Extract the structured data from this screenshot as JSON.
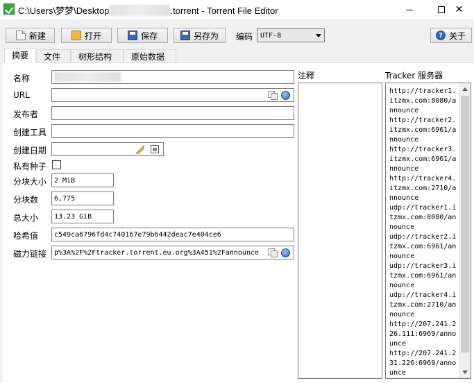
{
  "window": {
    "title_prefix": "C:\\Users\\梦梦\\Desktop",
    "title_suffix": ".torrent - Torrent File Editor"
  },
  "toolbar": {
    "new_label": "新建",
    "open_label": "打开",
    "save_label": "保存",
    "saveas_label": "另存为",
    "encoding_label": "编码",
    "encoding_value": "UTF-8",
    "about_label": "关于"
  },
  "tabs": [
    "摘要",
    "文件",
    "树形结构",
    "原始数据"
  ],
  "form": {
    "name_label": "名称",
    "url_label": "URL",
    "url_value": "",
    "publisher_label": "发布者",
    "publisher_value": "",
    "created_by_label": "创建工具",
    "created_by_value": "",
    "created_date_label": "创建日期",
    "created_date_value": "",
    "private_label": "私有种子",
    "private_checked": false,
    "piece_size_label": "分块大小",
    "piece_size_value": "2 MiB",
    "pieces_label": "分块数",
    "pieces_value": "6,775",
    "total_size_label": "总大小",
    "total_size_value": "13.23 GiB",
    "hash_label": "哈希值",
    "hash_value": "c549ca6796fd4c740167e79b6442deac7e404ce6",
    "magnet_label": "磁力链接",
    "magnet_value": "p%3A%2F%2Ftracker.torrent.eu.org%3A451%2Fannounce"
  },
  "notes": {
    "label": "注释"
  },
  "trackers": {
    "label": "Tracker 服务器",
    "items": [
      "http://tracker1.itzmx.com:8080/announce",
      "http://tracker2.itzmx.com:6961/announce",
      "http://tracker3.itzmx.com:6961/announce",
      "http://tracker4.itzmx.com:2710/announce",
      "udp://tracker1.itzmx.com:8080/announce",
      "udp://tracker2.itzmx.com:6961/announce",
      "udp://tracker3.itzmx.com:6961/announce",
      "udp://tracker4.itzmx.com:2710/announce",
      "http://207.241.226.111:6969/announce",
      "http://207.241.231.226:6969/announce"
    ]
  }
}
